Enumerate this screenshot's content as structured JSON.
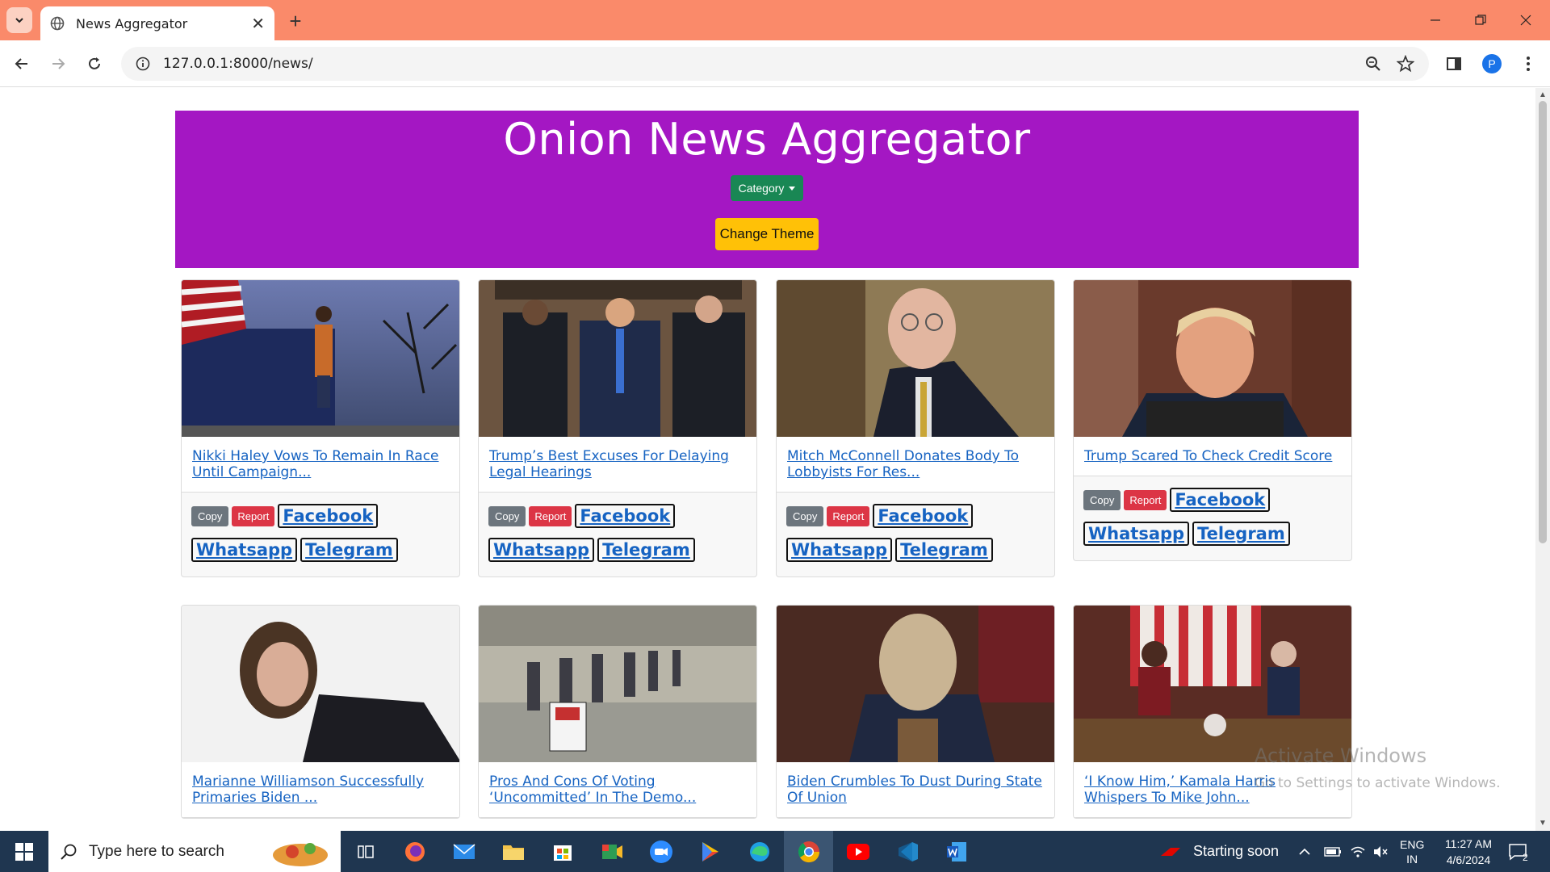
{
  "browser": {
    "tab_title": "News Aggregator",
    "tab_close": "✕",
    "new_tab": "+",
    "url": "127.0.0.1:8000/news/",
    "profile_initial": "P"
  },
  "page": {
    "heading": "Onion News Aggregator",
    "category_button": "Category",
    "theme_button": "Change Theme"
  },
  "card_buttons": {
    "copy": "Copy",
    "report": "Report",
    "facebook": "Facebook",
    "whatsapp": "Whatsapp",
    "telegram": "Telegram"
  },
  "articles": [
    {
      "title": "Nikki Haley Vows To Remain In Race Until Campaign..."
    },
    {
      "title": "Trump’s Best Excuses For Delaying Legal Hearings"
    },
    {
      "title": "Mitch McConnell Donates Body To Lobbyists For Res..."
    },
    {
      "title": "Trump Scared To Check Credit Score"
    },
    {
      "title": "Marianne Williamson Successfully Primaries Biden ..."
    },
    {
      "title": "Pros And Cons Of Voting ‘Uncommitted’ In The Demo..."
    },
    {
      "title": "Biden Crumbles To Dust During State Of Union"
    },
    {
      "title": "‘I Know Him,’ Kamala Harris Whispers To Mike John..."
    }
  ],
  "watermark": {
    "line1": "Activate Windows",
    "line2": "Go to Settings to activate Windows."
  },
  "taskbar": {
    "search_placeholder": "Type here to search",
    "notification_text": "Starting soon",
    "lang1": "ENG",
    "lang2": "IN",
    "time": "11:27 AM",
    "date": "4/6/2024",
    "notif_count": "2"
  },
  "colors": {
    "tabstrip": "#fa8a6a",
    "hero": "#a417c3",
    "category": "#198754",
    "theme": "#ffc107",
    "link": "#1663c2",
    "report": "#dc3545",
    "copy": "#6c757d",
    "taskbar": "#1f3650"
  }
}
